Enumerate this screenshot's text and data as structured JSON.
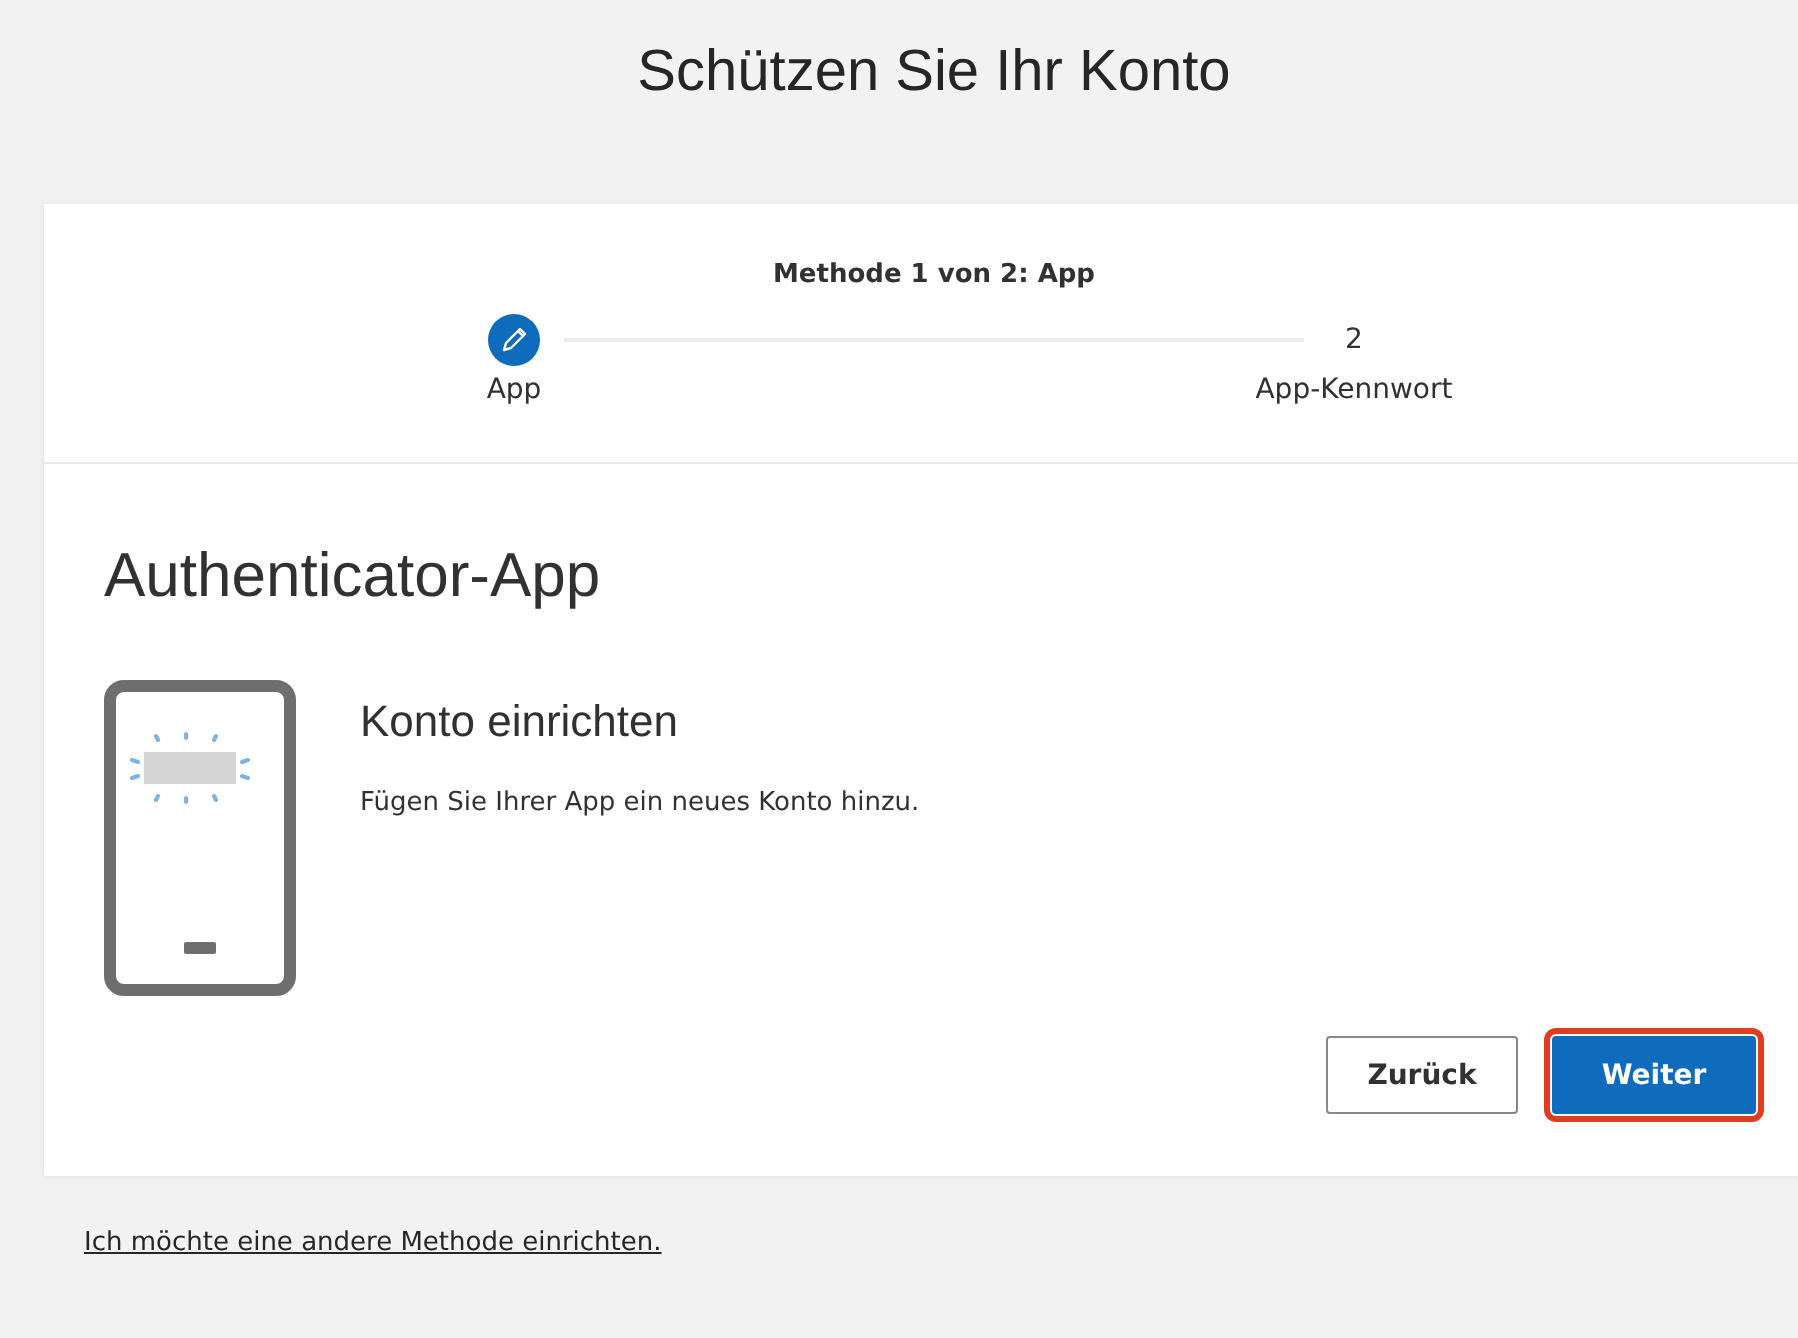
{
  "title": "Schützen Sie Ihr Konto",
  "progress": {
    "caption": "Methode 1 von 2: App",
    "steps": [
      {
        "label": "App",
        "selected": true
      },
      {
        "label": "App-Kennwort",
        "number": "2",
        "selected": false
      }
    ]
  },
  "section": {
    "heading": "Authenticator-App",
    "subheading": "Konto einrichten",
    "description": "Fügen Sie Ihrer App ein neues Konto hinzu."
  },
  "buttons": [
    {
      "label": "Zurück",
      "kind": "secondary",
      "highlighted": false
    },
    {
      "label": "Weiter",
      "kind": "primary",
      "highlighted": true
    }
  ],
  "footer_link": "Ich möchte eine andere Methode einrichten."
}
